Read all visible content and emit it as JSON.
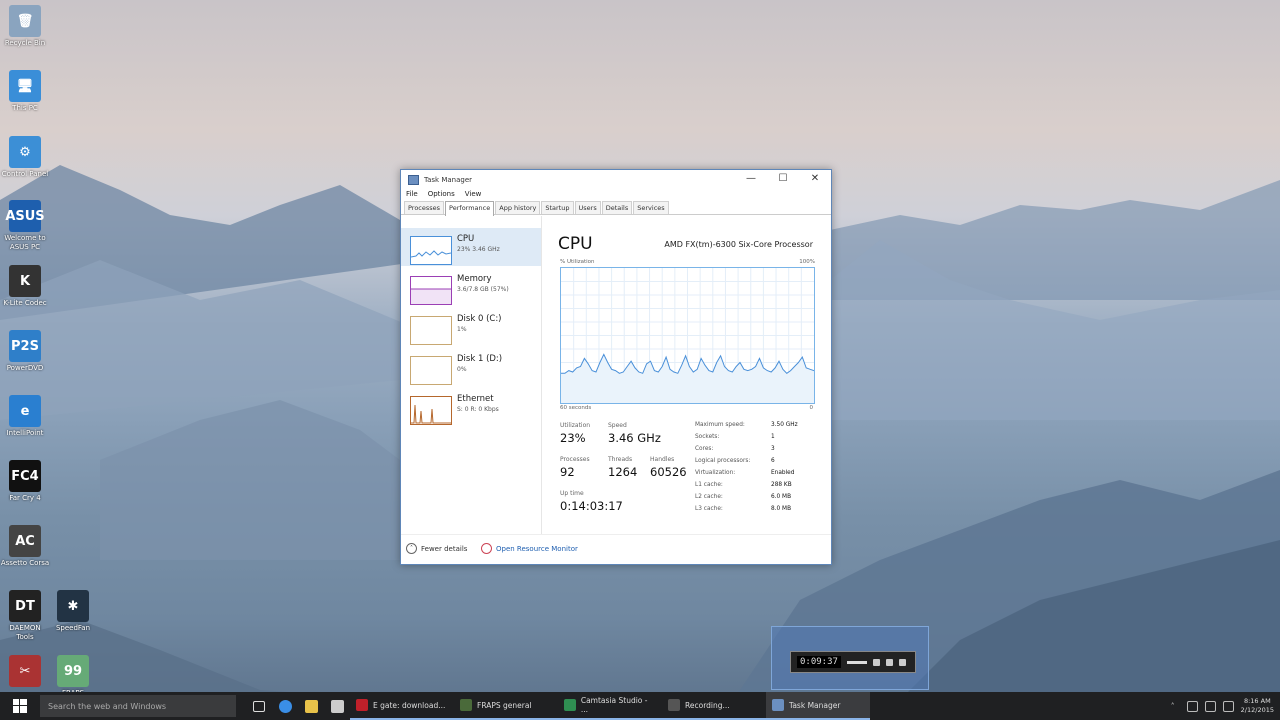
{
  "desktop_icons": [
    {
      "label": "Recycle Bin",
      "text": "🗑",
      "color": "#8aa4bf"
    },
    {
      "label": "This PC",
      "text": "🖥",
      "color": "#3a8ed8"
    },
    {
      "label": "Control Panel",
      "text": "⚙",
      "color": "#3c8fd6"
    },
    {
      "label": "Welcome to ASUS PC",
      "text": "ASUS",
      "color": "#1e5fae"
    },
    {
      "label": "K-Lite Codec",
      "text": "K",
      "color": "#333"
    },
    {
      "label": "PowerDVD",
      "text": "P2S",
      "color": "#2f7fc9"
    },
    {
      "label": "IntelliPoint",
      "text": "e",
      "color": "#2a7fd0"
    },
    {
      "label": "Far Cry 4",
      "text": "FC4",
      "color": "#111"
    },
    {
      "label": "Assetto Corsa",
      "text": "AC",
      "color": "#444"
    },
    {
      "label": "DAEMON Tools",
      "text": "DT",
      "color": "#222"
    },
    {
      "label": "SpeedFan",
      "text": "✱",
      "color": "#234"
    },
    {
      "label": "FRAPS",
      "text": "99",
      "color": "#6a7"
    },
    {
      "label": "",
      "text": "✂",
      "color": "#a33"
    }
  ],
  "window": {
    "title": "Task Manager",
    "minimize": "—",
    "maximize": "☐",
    "close": "✕",
    "menu": [
      "File",
      "Options",
      "View"
    ],
    "tabs": [
      "Processes",
      "Performance",
      "App history",
      "Startup",
      "Users",
      "Details",
      "Services"
    ],
    "active_tab": "Performance"
  },
  "sidebar": [
    {
      "name": "CPU",
      "sub": "23%  3.46 GHz",
      "color": "#4a90d9"
    },
    {
      "name": "Memory",
      "sub": "3.6/7.8 GB (57%)",
      "color": "#9b3fb5"
    },
    {
      "name": "Disk 0 (C:)",
      "sub": "1%",
      "color": "#7aa23a"
    },
    {
      "name": "Disk 1 (D:)",
      "sub": "0%",
      "color": "#7aa23a"
    },
    {
      "name": "Ethernet",
      "sub": "S: 0  R: 0 Kbps",
      "color": "#b5672c"
    }
  ],
  "panel": {
    "heading": "CPU",
    "model": "AMD FX(tm)-6300 Six-Core Processor",
    "util_label": "% Utilization",
    "util_max": "100%",
    "time_label": "60 seconds",
    "time_zero": "0"
  },
  "stats": {
    "utilization_label": "Utilization",
    "utilization": "23%",
    "speed_label": "Speed",
    "speed": "3.46 GHz",
    "processes_label": "Processes",
    "processes": "92",
    "threads_label": "Threads",
    "threads": "1264",
    "handles_label": "Handles",
    "handles": "60526",
    "uptime_label": "Up time",
    "uptime": "0:14:03:17"
  },
  "specs": [
    {
      "k": "Maximum speed:",
      "v": "3.50 GHz"
    },
    {
      "k": "Sockets:",
      "v": "1"
    },
    {
      "k": "Cores:",
      "v": "3"
    },
    {
      "k": "Logical processors:",
      "v": "6"
    },
    {
      "k": "Virtualization:",
      "v": "Enabled"
    },
    {
      "k": "L1 cache:",
      "v": "288 KB"
    },
    {
      "k": "L2 cache:",
      "v": "6.0 MB"
    },
    {
      "k": "L3 cache:",
      "v": "8.0 MB"
    }
  ],
  "footer": {
    "fewer": "Fewer details",
    "resmon": "Open Resource Monitor"
  },
  "cpu_history": [
    22,
    22,
    24,
    23,
    26,
    27,
    33,
    29,
    24,
    23,
    30,
    36,
    30,
    25,
    24,
    22,
    23,
    27,
    31,
    26,
    23,
    22,
    29,
    31,
    24,
    23,
    27,
    34,
    25,
    23,
    22,
    28,
    35,
    27,
    23,
    25,
    33,
    28,
    24,
    23,
    30,
    35,
    27,
    24,
    23,
    27,
    30,
    25,
    24,
    25,
    27,
    33,
    26,
    24,
    23,
    26,
    31,
    25,
    22,
    24,
    27,
    30,
    34,
    26,
    25,
    24
  ],
  "recorder": {
    "time": "0:09:37"
  },
  "taskbar": {
    "search_placeholder": "Search the web and Windows",
    "apps": [
      {
        "label": "E gate: download...",
        "color": "#c0202a",
        "active": false
      },
      {
        "label": "FRAPS general",
        "color": "#4a6a3a",
        "active": false
      },
      {
        "label": "Camtasia Studio - ...",
        "color": "#2f8e52",
        "active": false
      },
      {
        "label": "Recording...",
        "color": "#555",
        "active": false
      },
      {
        "label": "Task Manager",
        "color": "#6b8fc0",
        "active": true
      }
    ],
    "time": "8:16 AM",
    "date": "2/12/2015"
  }
}
